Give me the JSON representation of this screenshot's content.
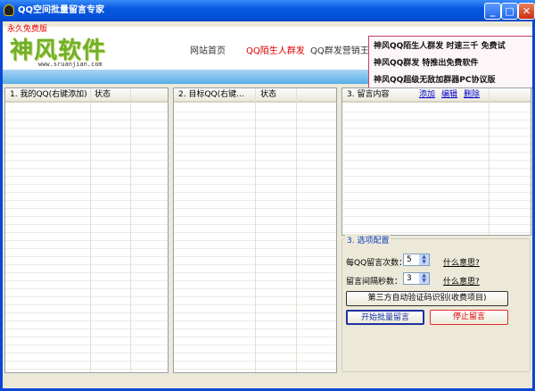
{
  "window": {
    "title": "QQ空间批量留言专家"
  },
  "header": {
    "free_label": "永久免费版",
    "logo": "神风软件",
    "logo_url": "www.sruanjian.com",
    "nav": [
      "网站首页",
      "QQ陌生人群发",
      "QQ群发营销王"
    ],
    "ads": [
      "神风QQ陌生人群发  时速三千  免费试",
      "神风QQ群发  特推出免费软件",
      "神风QQ超级无敌加群器PC协议版"
    ]
  },
  "panels": {
    "my_qq": {
      "columns": [
        "1. 我的QQ(右键添加)",
        "状态"
      ]
    },
    "target_qq": {
      "columns": [
        "2. 目标QQ(右键...",
        "状态"
      ]
    },
    "messages": {
      "title": "3. 留言内容",
      "actions": [
        "添加",
        "编辑",
        "删除"
      ]
    }
  },
  "config": {
    "title": "3. 选项配置",
    "count_label": "每QQ留言次数：",
    "count_value": "5",
    "interval_label": "留言间隔秒数：",
    "interval_value": "3",
    "help_link": "什么意思?",
    "captcha_button": "第三方自动验证码识别(收费项目)",
    "start_button": "开始批量留言",
    "stop_button": "停止留言"
  },
  "colors": {
    "accent_red": "#e00000",
    "link_blue": "#0000cc",
    "start_border": "#2030a0",
    "stop_border": "#e03030"
  }
}
